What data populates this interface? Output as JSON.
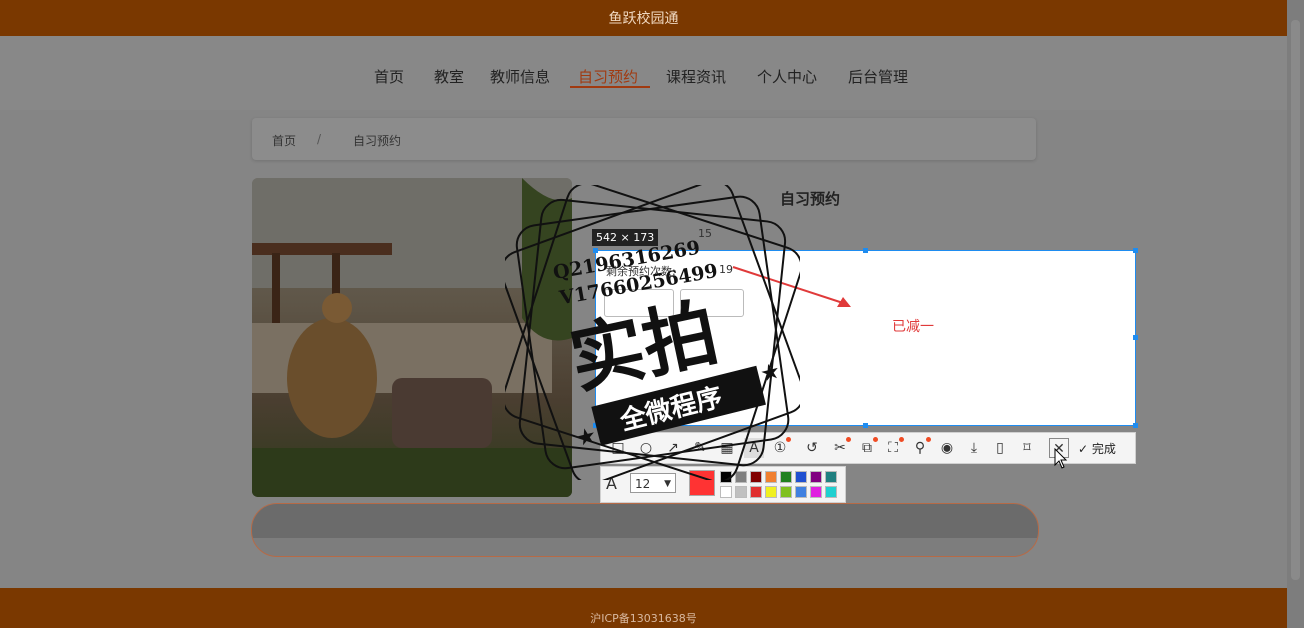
{
  "app": {
    "title": "鱼跃校园通"
  },
  "nav": {
    "items": [
      {
        "label": "首页"
      },
      {
        "label": "教室"
      },
      {
        "label": "教师信息"
      },
      {
        "label": "自习预约"
      },
      {
        "label": "课程资讯"
      },
      {
        "label": "个人中心"
      },
      {
        "label": "后台管理"
      }
    ],
    "active": "自习预约"
  },
  "breadcrumb": {
    "home": "首页",
    "separator": "/",
    "current": "自习预约"
  },
  "main": {
    "heading": "自习预约"
  },
  "capture": {
    "size_label": "542 × 173",
    "row1_value": "15",
    "row2_label": "剩余预约次数:",
    "row2_value": "19",
    "annotation": "已减一",
    "done_label": "完成",
    "font_size": "12",
    "current_color": "#ff3333",
    "palette_top": [
      "#000000",
      "#808080",
      "#800000",
      "#f08030",
      "#208020",
      "#2050d0",
      "#800080",
      "#208080"
    ],
    "palette_bottom": [
      "#ffffff",
      "#c0c0c0",
      "#e03030",
      "#f0f020",
      "#80c020",
      "#4080e0",
      "#e020e0",
      "#20d0d0"
    ]
  },
  "watermark": {
    "line1": "Q2196316269",
    "line2": "V17660256499",
    "main": "实拍",
    "banner": "全微程序"
  },
  "footer": {
    "icp": "沪ICP备13031638号"
  }
}
